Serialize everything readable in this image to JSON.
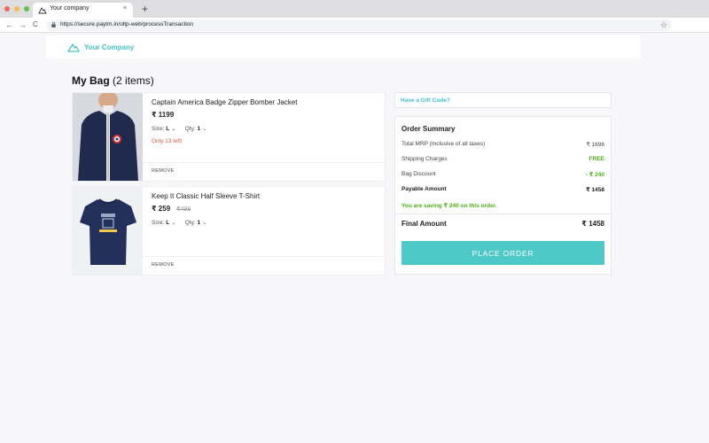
{
  "browser": {
    "tab_title": "Your company",
    "tab_close": "×",
    "new_tab": "+",
    "back": "←",
    "forward": "→",
    "reload": "C",
    "url": "https://secure.paytm.in/oltp-web/processTransaction",
    "bookmark": "☆"
  },
  "header": {
    "brand": "Your Company",
    "brand_color": "#42c2c8"
  },
  "bag": {
    "title": "My Bag",
    "count": "(2 items)",
    "items": [
      {
        "name": "Captain America Badge Zipper Bomber Jacket",
        "price": "₹ 1199",
        "mrp": "",
        "size_label": "Size:",
        "size": "L",
        "qty_label": "Qty:",
        "qty": "1",
        "stock_note": "Only 13 left!",
        "remove": "REMOVE"
      },
      {
        "name": "Keep It Classic Half Sleeve T-Shirt",
        "price": "₹ 259",
        "mrp": "₹499",
        "size_label": "Size:",
        "size": "L",
        "qty_label": "Qty:",
        "qty": "1",
        "stock_note": "",
        "remove": "REMOVE"
      }
    ]
  },
  "gift": {
    "label": "Have a Gift Code?"
  },
  "summary": {
    "title": "Order Summary",
    "rows": [
      {
        "label": "Total MRP (Inclusive of all taxes)",
        "value": "₹ 1698"
      },
      {
        "label": "Shipping Charges",
        "value": "FREE"
      },
      {
        "label": "Bag Discount",
        "value": "- ₹ 240"
      },
      {
        "label": "Payable Amount",
        "value": "₹ 1458"
      }
    ],
    "saving_note": "You are saving ₹ 240 on this order.",
    "final_label": "Final Amount",
    "final_value": "₹ 1458",
    "place_order": "PLACE ORDER"
  },
  "colors": {
    "accent": "#4ec9c7",
    "discount_green": "#4caf1a",
    "stock_red": "#e5533d"
  }
}
